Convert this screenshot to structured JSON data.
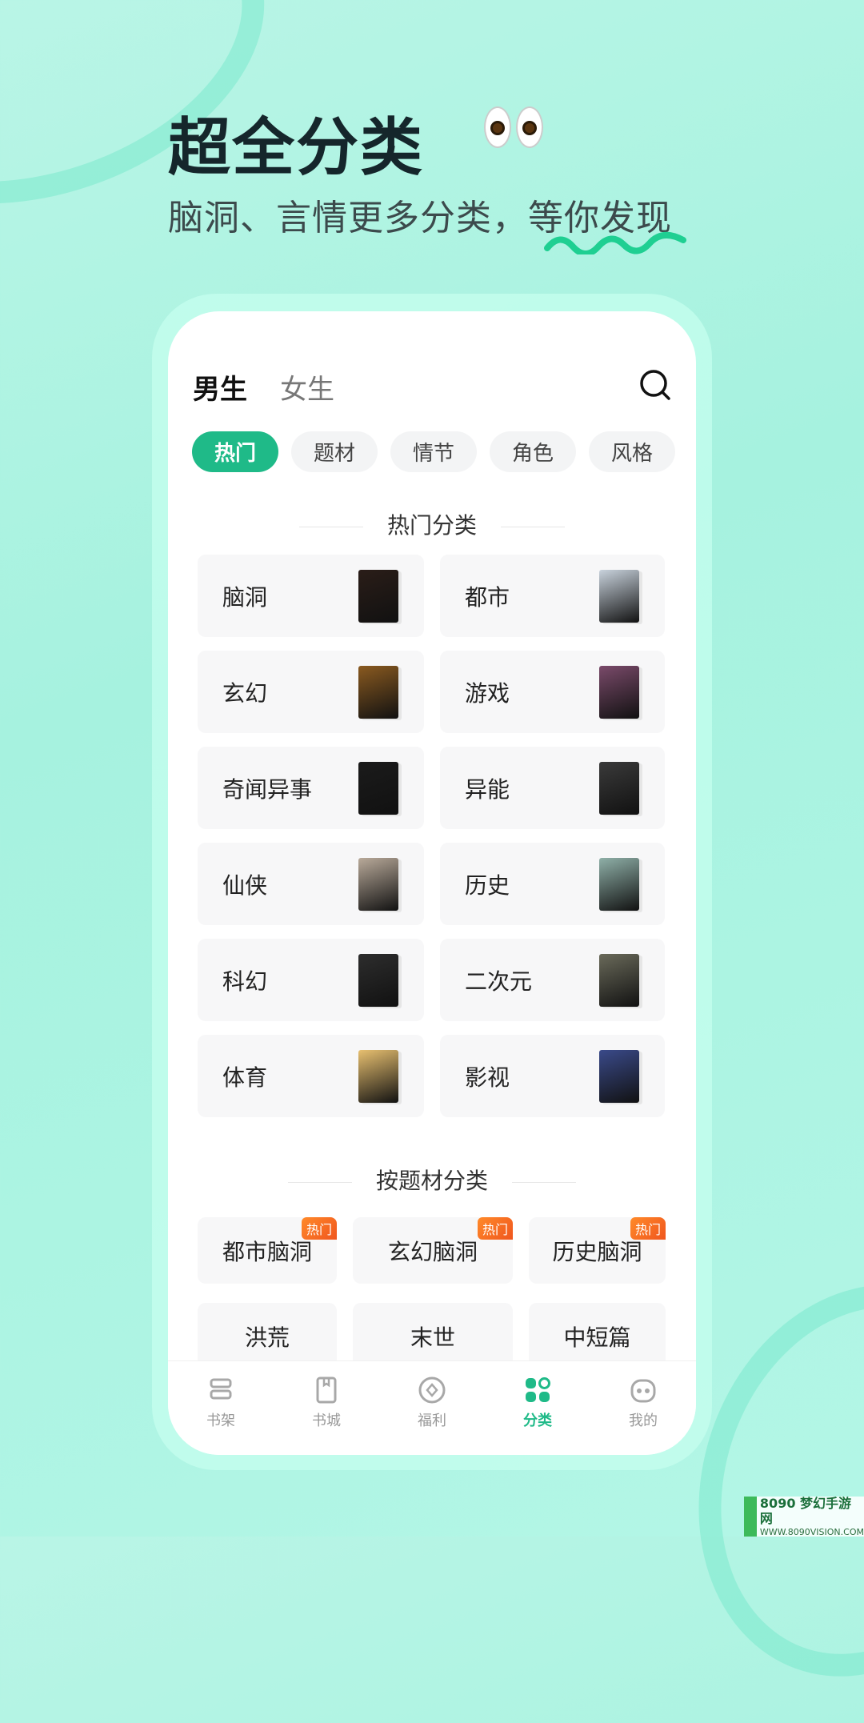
{
  "promo": {
    "title": "超全分类",
    "subtitle": "脑洞、言情更多分类，等你发现"
  },
  "tabs": [
    {
      "label": "男生",
      "active": true
    },
    {
      "label": "女生",
      "active": false
    }
  ],
  "chips": [
    {
      "label": "热门",
      "active": true
    },
    {
      "label": "题材"
    },
    {
      "label": "情节"
    },
    {
      "label": "角色"
    },
    {
      "label": "风格"
    }
  ],
  "hot_section": {
    "title": "热门分类",
    "items": [
      {
        "label": "脑洞",
        "cover": "#2a1d18"
      },
      {
        "label": "都市",
        "cover": "#c9d3dd"
      },
      {
        "label": "玄幻",
        "cover": "#8a5a20"
      },
      {
        "label": "游戏",
        "cover": "#7a4a6a"
      },
      {
        "label": "奇闻异事",
        "cover": "#1b1b1b"
      },
      {
        "label": "异能",
        "cover": "#3a3a3a"
      },
      {
        "label": "仙侠",
        "cover": "#b9aa9a"
      },
      {
        "label": "历史",
        "cover": "#8fb0a8"
      },
      {
        "label": "科幻",
        "cover": "#2d2d2d"
      },
      {
        "label": "二次元",
        "cover": "#6a6a5a"
      },
      {
        "label": "体育",
        "cover": "#e8c070"
      },
      {
        "label": "影视",
        "cover": "#3a4a8a"
      }
    ]
  },
  "subject_section": {
    "title": "按题材分类",
    "badge": "热门",
    "items": [
      {
        "label": "都市脑洞",
        "hot": true
      },
      {
        "label": "玄幻脑洞",
        "hot": true
      },
      {
        "label": "历史脑洞",
        "hot": true
      },
      {
        "label": "洪荒",
        "hot": false
      },
      {
        "label": "末世",
        "hot": false
      },
      {
        "label": "中短篇",
        "hot": false
      }
    ]
  },
  "nav": [
    {
      "label": "书架",
      "icon": "bookshelf-icon"
    },
    {
      "label": "书城",
      "icon": "bookstore-icon"
    },
    {
      "label": "福利",
      "icon": "coin-icon"
    },
    {
      "label": "分类",
      "icon": "category-icon",
      "active": true
    },
    {
      "label": "我的",
      "icon": "panda-icon"
    }
  ],
  "accent": "#1fba88",
  "watermark": {
    "line1": "8090",
    "line2": "梦幻手游网",
    "line3": "WWW.8090VISION.COM"
  }
}
